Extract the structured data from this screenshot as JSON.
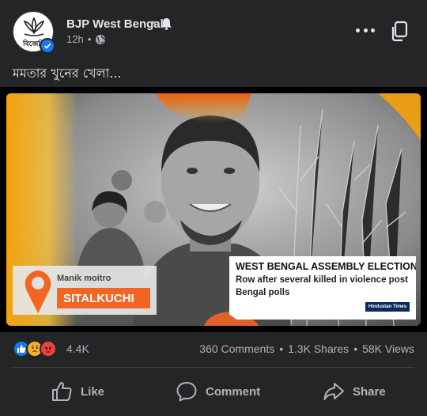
{
  "post": {
    "page_name": "BJP West Bengal",
    "avatar_text": "বিজেপি",
    "time": "12h",
    "dot": "•",
    "caption": "মমতার খুনের খেলা..."
  },
  "media": {
    "person_name": "Manik moitro",
    "location": "SITALKUCHI",
    "news_title": "WEST BENGAL ASSEMBLY ELECTION",
    "news_subtitle": "Row after several killed in violence post Bengal polls",
    "source_logo": "Hindustan Times"
  },
  "stats": {
    "reaction_count": "4.4K",
    "comments": "360 Comments",
    "shares": "1.3K Shares",
    "views": "58K Views",
    "separator": "•"
  },
  "actions": {
    "like": "Like",
    "comment": "Comment",
    "share": "Share"
  },
  "colors": {
    "background": "#242526",
    "text": "#e4e6eb",
    "muted": "#b0b3b8",
    "accent": "#1877f2",
    "location_badge": "#f26522"
  },
  "icons": [
    "bell-icon",
    "globe-icon",
    "more-icon",
    "copy-icon",
    "verified-icon",
    "like-icon",
    "comment-icon",
    "share-icon",
    "location-pin-icon"
  ]
}
